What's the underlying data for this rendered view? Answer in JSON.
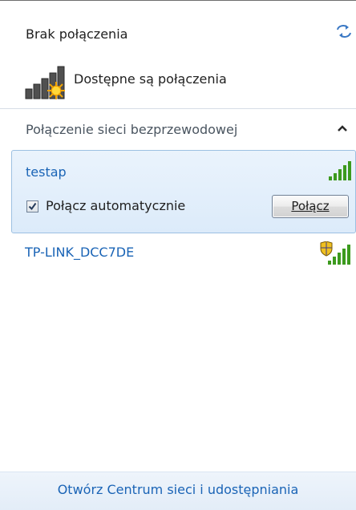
{
  "header": {
    "status": "Brak połączenia",
    "available": "Dostępne są połączenia",
    "refresh_icon": "refresh-icon"
  },
  "section": {
    "title": "Połączenie sieci bezprzewodowej",
    "collapse_icon": "chevron-up-icon"
  },
  "networks": [
    {
      "name": "testap",
      "signal_bars": 5,
      "secured": false,
      "selected": true,
      "auto_connect_label": "Połącz automatycznie",
      "auto_connect_checked": true,
      "connect_button": "Połącz"
    },
    {
      "name": "TP-LINK_DCC7DE",
      "signal_bars": 5,
      "secured": true,
      "selected": false
    }
  ],
  "footer": {
    "link": "Otwórz Centrum sieci i udostępniania"
  },
  "colors": {
    "link": "#1a64b6",
    "selection_border": "#9cc0e2",
    "signal": "#3c9a1e"
  }
}
